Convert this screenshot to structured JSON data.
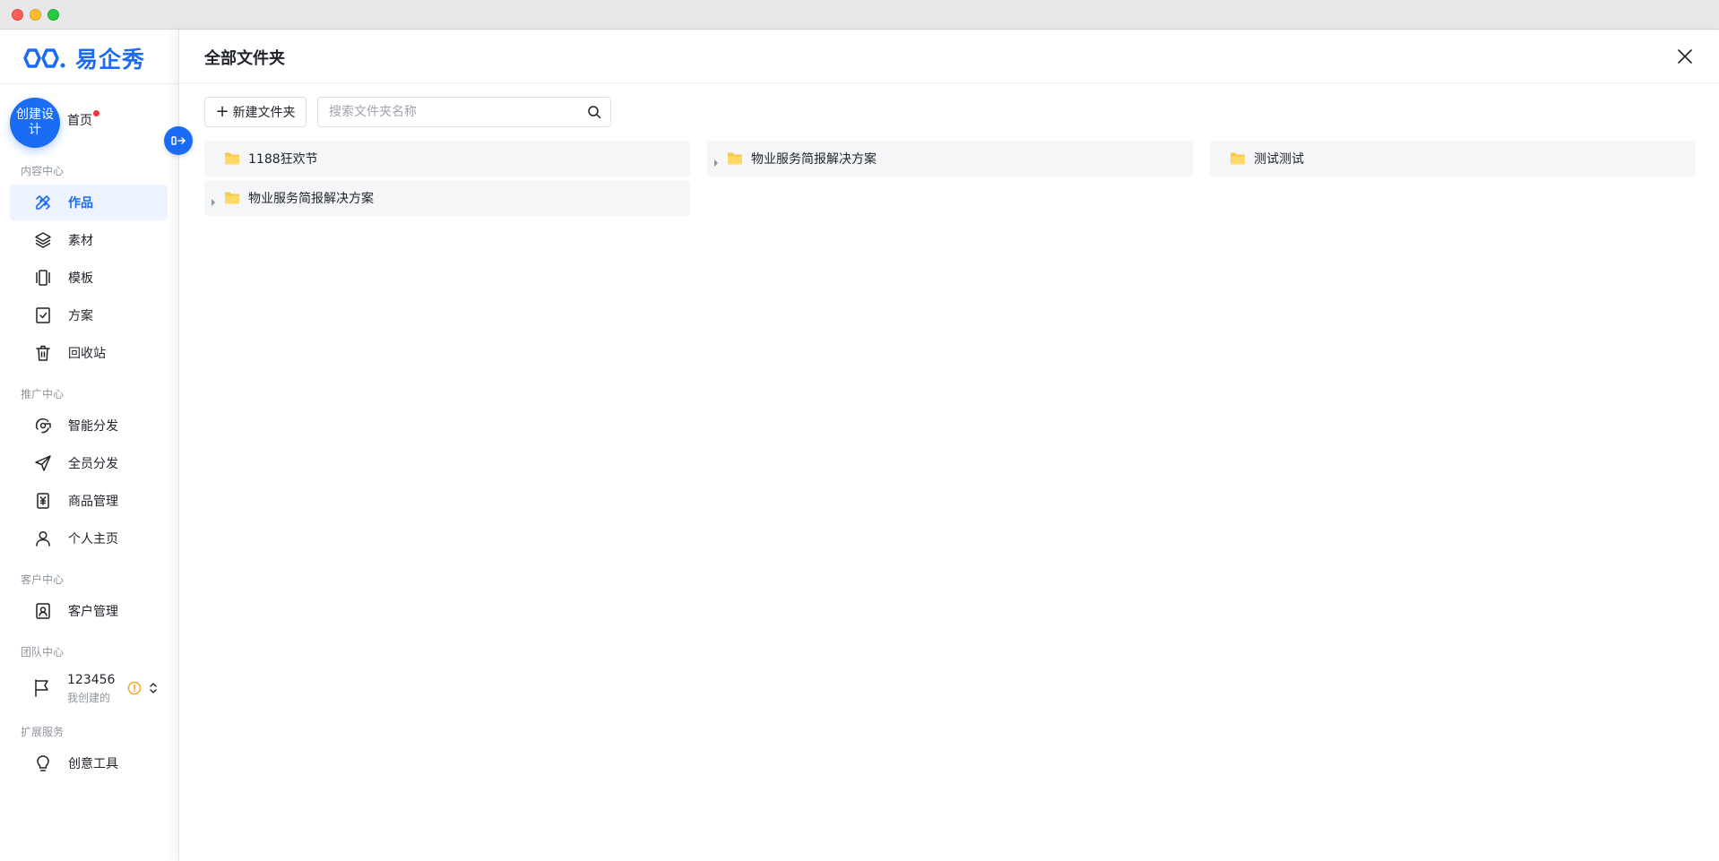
{
  "app": {
    "brand": "易企秀"
  },
  "sidebar": {
    "create_label": "创建设计",
    "home_label": "首页",
    "sections": {
      "content": "内容中心",
      "promotion": "推广中心",
      "customer": "客户中心",
      "team": "团队中心",
      "extension": "扩展服务"
    },
    "items": [
      {
        "label": "作品",
        "icon": "works-icon",
        "active": true
      },
      {
        "label": "素材",
        "icon": "layers-icon"
      },
      {
        "label": "模板",
        "icon": "template-icon"
      },
      {
        "label": "方案",
        "icon": "checklist-icon"
      },
      {
        "label": "回收站",
        "icon": "trash-icon"
      },
      {
        "label": "智能分发",
        "icon": "smart-share-icon"
      },
      {
        "label": "全员分发",
        "icon": "send-icon"
      },
      {
        "label": "商品管理",
        "icon": "product-icon"
      },
      {
        "label": "个人主页",
        "icon": "user-icon"
      },
      {
        "label": "客户管理",
        "icon": "contacts-icon"
      },
      {
        "label": "创意工具",
        "icon": "bulb-icon"
      }
    ],
    "team": {
      "name": "123456",
      "subtitle": "我创建的"
    },
    "accent_color": "#1a6cf5"
  },
  "panel": {
    "title": "全部文件夹",
    "new_folder_label": "新建文件夹",
    "search_placeholder": "搜索文件夹名称",
    "folders": [
      {
        "name": "1188狂欢节",
        "expandable": false
      },
      {
        "name": "物业服务简报解决方案",
        "expandable": true
      },
      {
        "name": "测试测试",
        "expandable": false
      },
      {
        "name": "物业服务简报解决方案",
        "expandable": true
      }
    ]
  }
}
